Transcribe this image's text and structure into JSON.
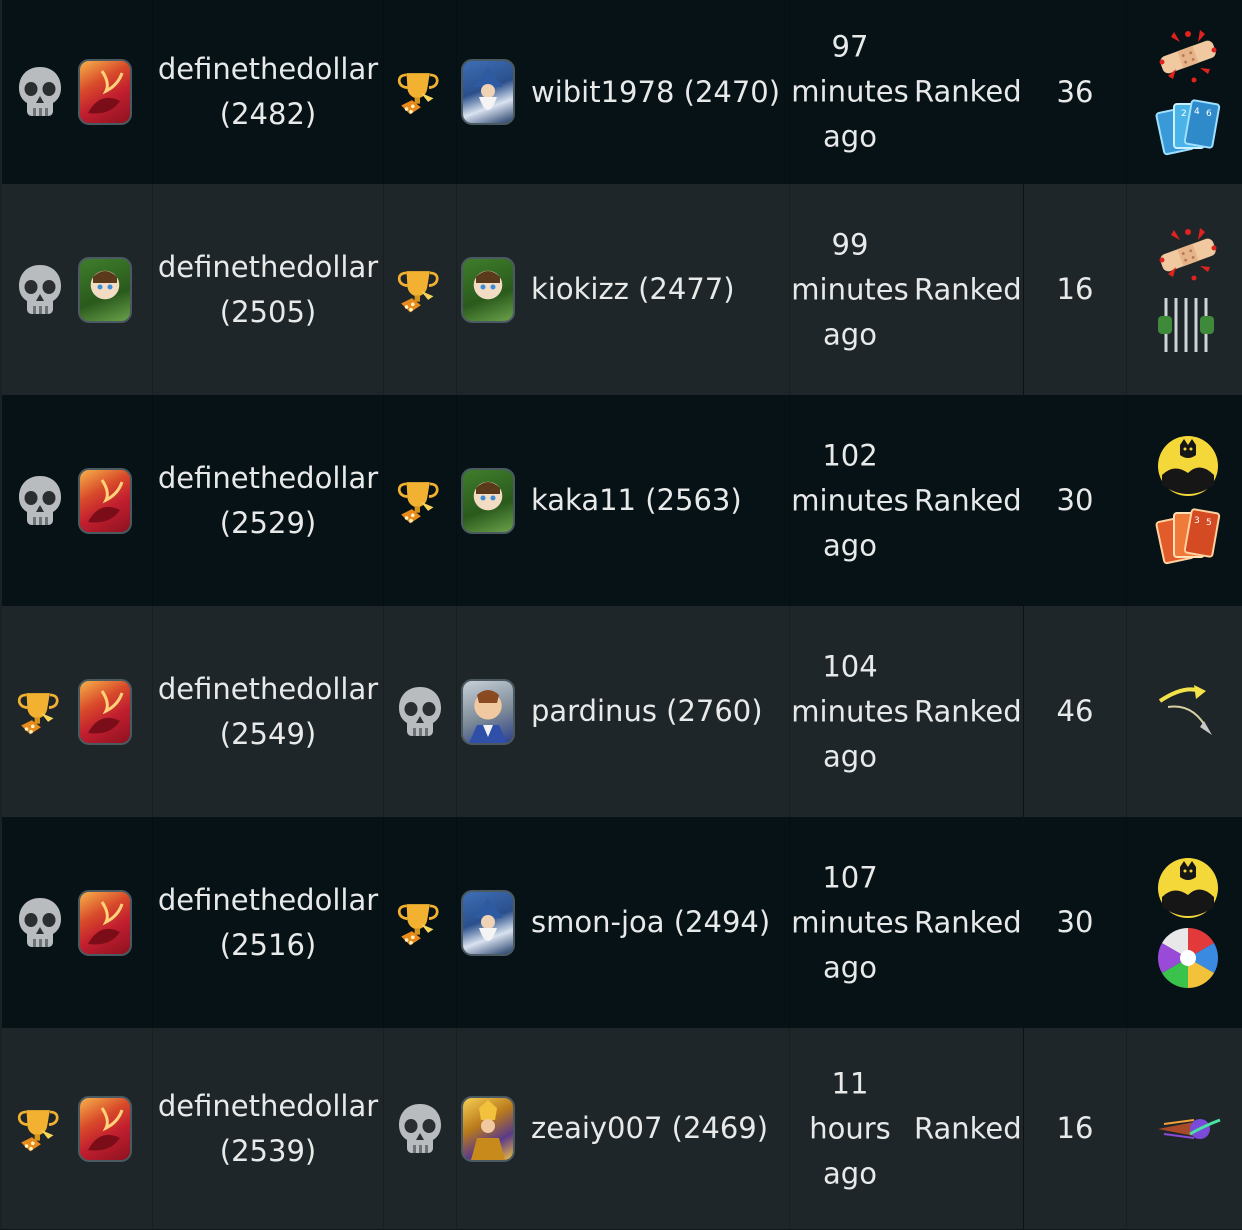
{
  "rows": [
    {
      "player": "definethedollar",
      "player_rating": "(2482)",
      "player_result": "skull-icon",
      "player_avatar": "red-dragon-avatar",
      "opponent": "wibit1978 (2470)",
      "opponent_result": "trophy-icon",
      "opponent_avatar": "blue-wizard-avatar",
      "time": [
        "97",
        "minutes",
        "ago"
      ],
      "type": "Ranked",
      "turns": "36",
      "icons": [
        "bandage-icon",
        "blue-cards-icon"
      ]
    },
    {
      "player": "definethedollar",
      "player_rating": "(2505)",
      "player_result": "skull-icon",
      "player_avatar": "green-elf-avatar",
      "opponent": "kiokizz (2477)",
      "opponent_result": "trophy-icon",
      "opponent_avatar": "green-elf-avatar",
      "time": [
        "99",
        "minutes",
        "ago"
      ],
      "type": "Ranked",
      "turns": "16",
      "icons": [
        "bandage-icon",
        "cage-icon"
      ]
    },
    {
      "player": "definethedollar",
      "player_rating": "(2529)",
      "player_result": "skull-icon",
      "player_avatar": "red-dragon-avatar",
      "opponent": "kaka11 (2563)",
      "opponent_result": "trophy-icon",
      "opponent_avatar": "green-elf-avatar",
      "time": [
        "102",
        "minutes",
        "ago"
      ],
      "type": "Ranked",
      "turns": "30",
      "icons": [
        "moon-beasts-icon",
        "red-cards-icon"
      ]
    },
    {
      "player": "definethedollar",
      "player_rating": "(2549)",
      "player_result": "trophy-icon",
      "player_avatar": "red-dragon-avatar",
      "opponent": "pardinus (2760)",
      "opponent_result": "skull-icon",
      "opponent_avatar": "knight-avatar",
      "time": [
        "104",
        "minutes",
        "ago"
      ],
      "type": "Ranked",
      "turns": "46",
      "icons": [
        "spark-arrow-icon"
      ]
    },
    {
      "player": "definethedollar",
      "player_rating": "(2516)",
      "player_result": "skull-icon",
      "player_avatar": "red-dragon-avatar",
      "opponent": "smon-joa (2494)",
      "opponent_result": "trophy-icon",
      "opponent_avatar": "blue-wizard-avatar",
      "time": [
        "107",
        "minutes",
        "ago"
      ],
      "type": "Ranked",
      "turns": "30",
      "icons": [
        "moon-beasts-icon",
        "elements-wheel-icon"
      ]
    },
    {
      "player": "definethedollar",
      "player_rating": "(2539)",
      "player_result": "trophy-icon",
      "player_avatar": "red-dragon-avatar",
      "opponent": "zeaiy007 (2469)",
      "opponent_result": "skull-icon",
      "opponent_avatar": "golden-warrior-avatar",
      "time": [
        "11",
        "hours",
        "ago"
      ],
      "type": "Ranked",
      "turns": "16",
      "icons": [
        "comet-icon"
      ]
    }
  ]
}
